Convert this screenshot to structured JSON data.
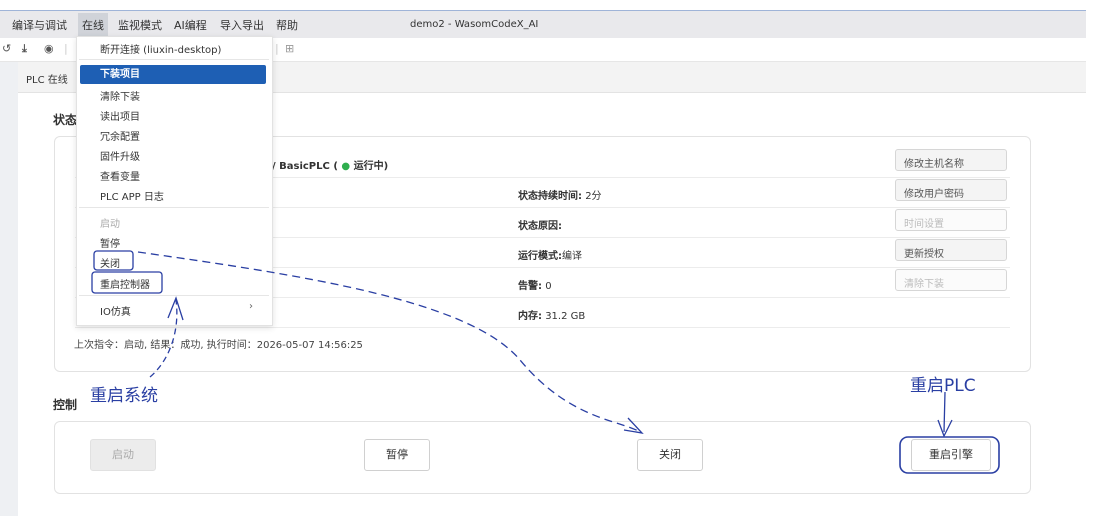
{
  "menubar": {
    "items": [
      "编译与调试",
      "在线",
      "监视模式",
      "AI编程",
      "导入导出",
      "帮助"
    ],
    "window_title": "demo2 - WasomCodeX_AI"
  },
  "tab": {
    "label": "PLC 在线"
  },
  "status": {
    "section_title": "状态",
    "device_text": "/ BasicPLC (",
    "running_text": "运行中)",
    "duration_label": "状态持续时间:",
    "duration_value": "2分",
    "reason_label": "状态原因:",
    "mode_label": "运行模式:",
    "mode_value": "编译",
    "alarm_label": "告警:",
    "alarm_value": "0",
    "memory_label": "内存:",
    "memory_value": "31.2 GB",
    "last_command": "上次指令：启动, 结果：成功, 执行时间：2026-05-07 14:56:25",
    "side_buttons": [
      "修改主机名称",
      "修改用户密码",
      "时间设置",
      "更新授权",
      "清除下装"
    ]
  },
  "control": {
    "section_title": "控制",
    "start": "启动",
    "pause": "暂停",
    "close": "关闭",
    "restart_engine": "重启引擎"
  },
  "dropdown": {
    "disconnect": "断开连接 (liuxin-desktop)",
    "download": "下装项目",
    "clear_download": "清除下装",
    "read_project": "读出项目",
    "redundancy": "冗余配置",
    "firmware": "固件升级",
    "view_vars": "查看变量",
    "app_log": "PLC APP 日志",
    "start": "启动",
    "pause": "暂停",
    "close": "关闭",
    "restart_controller": "重启控制器",
    "io_sim": "IO仿真"
  },
  "annotations": {
    "restart_system": "重启系统",
    "restart_plc": "重启PLC"
  },
  "colors": {
    "accent": "#1e5fb4",
    "running": "#2fae4e",
    "annotation": "#2a3fa3"
  }
}
